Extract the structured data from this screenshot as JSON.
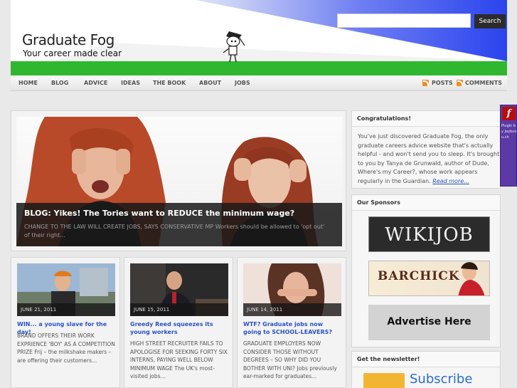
{
  "header": {
    "logo_title": "Graduate Fog",
    "logo_tagline": "Your career made clear",
    "search": {
      "placeholder": "",
      "button_label": "Search"
    },
    "colors": {
      "grass": "#2fb82f",
      "sky": "#2a44ee"
    }
  },
  "nav": {
    "items": [
      "HOME",
      "BLOG",
      "ADVICE",
      "IDEAS",
      "THE BOOK",
      "ABOUT",
      "JOBS"
    ],
    "feeds": [
      "POSTS",
      "COMMENTS"
    ],
    "feed_icon": "rss-icon"
  },
  "feature": {
    "title": "BLOG: Yikes! The Tories want to REDUCE the minimum wage?",
    "excerpt": "CHANGE TO THE LAW WILL CREATE JOBS, SAYS CONSERVATIVE MP Workers should be allowed to 'opt out' of their right..."
  },
  "posts": [
    {
      "date": "JUNE 21, 2011",
      "title": "WIN... a young slave for the day!",
      "excerpt": "BRAND OFFERS THEIR WORK EXPRIENCE 'BOY' AS A COMPETITION PRIZE Frij – the milkshake makers – are offering their customers..."
    },
    {
      "date": "JUNE 15, 2011",
      "title": "Greedy Reed squeezes its young workers",
      "excerpt": "HIGH STREET RECRUITER FAILS TO APOLOGISE FOR SEEKING FORTY SIX INTERNS, PAYING WELL BELOW MINIMUM WAGE The UK's most-visited jobs..."
    },
    {
      "date": "JUNE 14, 2011",
      "title": "WTF? Graduate jobs now going to SCHOOL-LEAVERS?",
      "excerpt": "GRADUATE EMPLOYERS NOW CONSIDER THOSE WITHOUT DEGREES – SO WHY DID YOU BOTHER WITH UNI? Jobs previously ear-marked for graduates..."
    }
  ],
  "sidebar": {
    "congrats": {
      "heading": "Congratulations!",
      "text": "You've just discovered Graduate Fog, the only graduate careers advice website that's actually helpful - and won't send you to sleep. It's brought to you by Tanya de Grunwald, author of Dude, Where's my Career?, whose work appears regularly in the Guardian.",
      "link": "Read more..."
    },
    "sponsors": {
      "heading": "Our Sponsors",
      "items": [
        "WIKIJOB",
        "BARCHICK",
        "Advertise Here"
      ]
    },
    "newsletter": {
      "heading": "Get the newsletter!",
      "subscribe": "Subscribe"
    }
  },
  "flash_plugin": {
    "icon": "flash-icon",
    "text": "Plugin by Jaybunu.ch"
  }
}
